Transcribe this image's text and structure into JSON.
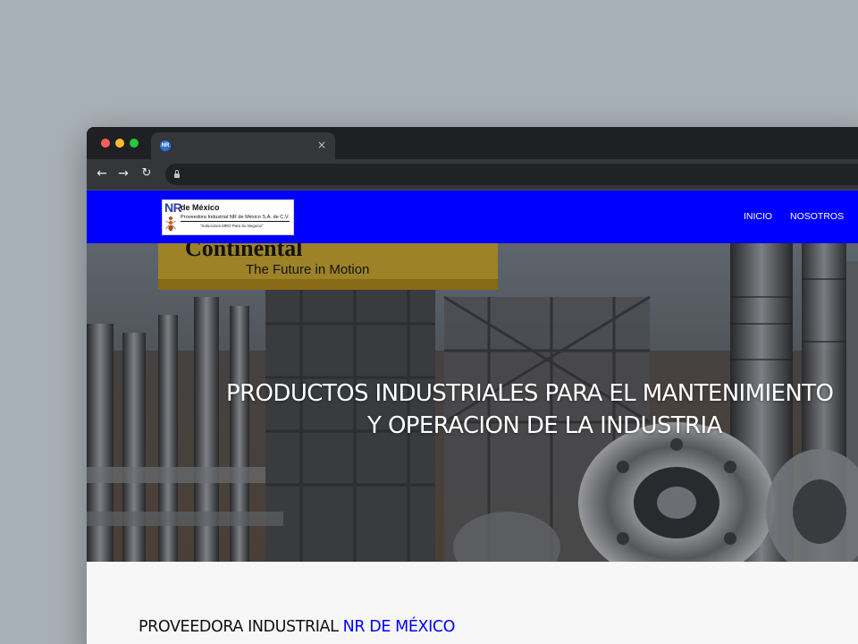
{
  "browser": {
    "tab": {
      "favicon": "nr-favicon-icon",
      "title": "",
      "close_label": "×"
    },
    "toolbar": {
      "back": "←",
      "forward": "→",
      "reload": "↻",
      "url": ""
    }
  },
  "site": {
    "header_color": "#0000ff",
    "logo": {
      "mark": "NR",
      "title": "de México",
      "subtitle": "Proveedora Industrial NR de México S.A. de C.V.",
      "slogan": "\"Soluciones MRO Para Su Negocio\""
    },
    "nav": [
      {
        "label": "INICIO"
      },
      {
        "label": "NOSOTROS"
      }
    ]
  },
  "hero": {
    "line1": "PRODUCTOS INDUSTRIALES PARA EL MANTENIMIENTO",
    "line2": "Y OPERACION DE LA INDUSTRIA",
    "sign_text": "The Future in Motion",
    "sign_brand": "Continental"
  },
  "section": {
    "heading_prefix": "PROVEEDORA INDUSTRIAL ",
    "heading_accent": "NR DE MÉXICO",
    "accent_color": "#0000ff"
  }
}
